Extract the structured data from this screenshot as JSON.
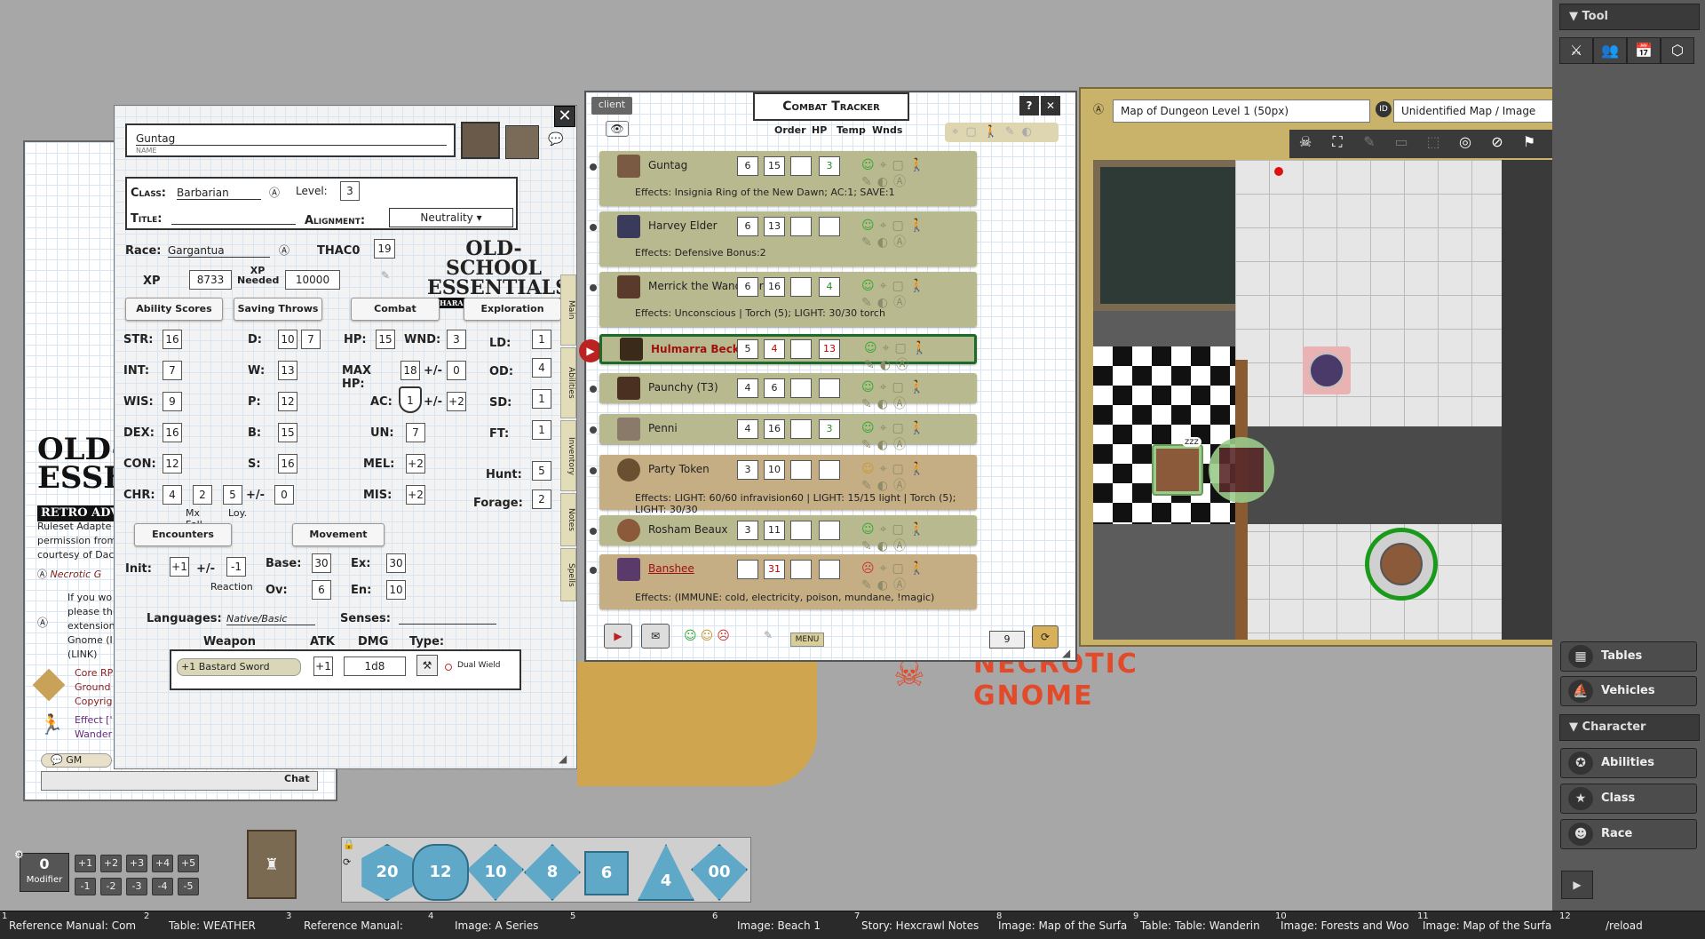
{
  "char_sheet": {
    "name": "Guntag",
    "name_caption": "NAME",
    "class_label": "Class:",
    "class": "Barbarian",
    "level_label": "Level:",
    "level": "3",
    "title_label": "Title:",
    "alignment_label": "Alignment:",
    "alignment": "Neutrality",
    "race_label": "Race:",
    "race": "Gargantua",
    "thac0_label": "THAC0",
    "thac0": "19",
    "xp_label": "XP",
    "xp": "8733",
    "xp_needed_label": "XP Needed",
    "xp_needed": "10000",
    "logo_line1": "OLD-SCHOOL",
    "logo_line2": "ESSENTIALS",
    "logo_line3": "CHARACTER RECORD SHEET",
    "sections": [
      "Ability Scores",
      "Saving Throws",
      "Combat",
      "Exploration"
    ],
    "abilities": [
      {
        "label": "STR:",
        "value": "16"
      },
      {
        "label": "INT:",
        "value": "7"
      },
      {
        "label": "WIS:",
        "value": "9"
      },
      {
        "label": "DEX:",
        "value": "16"
      },
      {
        "label": "CON:",
        "value": "12"
      },
      {
        "label": "CHR:",
        "value": "4"
      }
    ],
    "chr_extra": {
      "mx_foll": "2",
      "loy": "5",
      "pm": "0",
      "mx_foll_label": "Mx Foll",
      "loy_label": "Loy."
    },
    "saves": [
      {
        "label": "D:",
        "value": "10",
        "mod": "7"
      },
      {
        "label": "W:",
        "value": "13"
      },
      {
        "label": "P:",
        "value": "12"
      },
      {
        "label": "B:",
        "value": "15"
      },
      {
        "label": "S:",
        "value": "16"
      }
    ],
    "combat": {
      "hp_label": "HP:",
      "hp": "15",
      "wnd_label": "WND:",
      "wnd": "3",
      "maxhp_label": "MAX HP:",
      "maxhp": "18",
      "maxhp_pm": "0",
      "ac_label": "AC:",
      "ac": "1",
      "ac_pm": "+2",
      "un_label": "UN:",
      "un": "7",
      "mel_label": "MEL:",
      "mel": "+2",
      "mis_label": "MIS:",
      "mis": "+2",
      "pm_label": "+/-"
    },
    "exploration": [
      {
        "label": "LD:",
        "value": "1"
      },
      {
        "label": "OD:",
        "value": "4"
      },
      {
        "label": "SD:",
        "value": "1"
      },
      {
        "label": "FT:",
        "value": "1"
      },
      {
        "label": "Hunt:",
        "value": "5"
      },
      {
        "label": "Forage:",
        "value": "2"
      }
    ],
    "encounters_label": "Encounters",
    "movement_label": "Movement",
    "init_label": "Init:",
    "init": "+1",
    "init_pm": "-1",
    "reaction_label": "Reaction",
    "base_label": "Base:",
    "base": "30",
    "ex_label": "Ex:",
    "ex": "30",
    "ov_label": "Ov:",
    "ov": "6",
    "en_label": "En:",
    "en": "10",
    "languages_label": "Languages:",
    "languages": "Native/Basic",
    "senses_label": "Senses:",
    "weapon_header": "Weapon",
    "atk_header": "ATK",
    "dmg_header": "DMG",
    "type_header": "Type:",
    "weapon": {
      "name": "+1 Bastard Sword",
      "atk": "+1",
      "dmg": "1d8",
      "dual": "Dual Wield"
    },
    "side_tabs": [
      "Main",
      "Abilities",
      "Inventory",
      "Notes",
      "Spells"
    ]
  },
  "chat": {
    "logo1": "OLD-S",
    "logo2": "ESSE",
    "logo3": "RETRO ADV",
    "lines": [
      "Ruleset Adapte",
      "permission from",
      "courtesy of Dac"
    ],
    "necrotic": "Necrotic G",
    "ext_lines": [
      "If you wo",
      "please thi",
      "extension",
      "Gnome (I",
      "(LINK)"
    ],
    "core": [
      "Core RP",
      "Ground",
      "Copyrig"
    ],
    "effect": [
      "Effect ['",
      "Wander"
    ],
    "gm_label": "GM",
    "chat_btn": "Chat"
  },
  "combat_tracker": {
    "title": "Combat Tracker",
    "client_tab": "client",
    "col_order": "Order",
    "col_hp": "HP",
    "col_temp": "Temp",
    "col_wnds": "Wnds",
    "rows": [
      {
        "name": "Guntag",
        "order": "6",
        "hp": "15",
        "temp": "",
        "wnds": "3",
        "effects": "Effects: Insignia Ring of the New Dawn; AC:1; SAVE:1"
      },
      {
        "name": "Harvey Elder",
        "order": "6",
        "hp": "13",
        "temp": "",
        "wnds": "",
        "effects": "Effects: Defensive Bonus:2"
      },
      {
        "name": "Merrick the Wanderer",
        "order": "6",
        "hp": "16",
        "temp": "",
        "wnds": "4",
        "effects": "Effects: Unconscious | Torch (5); LIGHT: 30/30 torch"
      },
      {
        "name": "Hulmarra Beckett",
        "order": "5",
        "hp": "4",
        "temp": "",
        "wnds": "13",
        "effects": ""
      },
      {
        "name": "Paunchy (T3)",
        "order": "4",
        "hp": "6",
        "temp": "",
        "wnds": "",
        "effects": ""
      },
      {
        "name": "Penni",
        "order": "4",
        "hp": "16",
        "temp": "",
        "wnds": "3",
        "effects": ""
      },
      {
        "name": "Party Token",
        "order": "3",
        "hp": "10",
        "temp": "",
        "wnds": "",
        "effects": "Effects: LIGHT: 60/60 infravision60 | LIGHT: 15/15 light | Torch (5); LIGHT: 30/30"
      },
      {
        "name": "Rosham Beaux",
        "order": "3",
        "hp": "11",
        "temp": "",
        "wnds": "",
        "effects": ""
      },
      {
        "name": "Banshee",
        "order": "",
        "hp": "31",
        "temp": "",
        "wnds": "",
        "effects": "Effects: (IMMUNE: cold, electricity, poison, mundane, !magic)"
      }
    ],
    "menu_label": "MENU",
    "round": "9",
    "help": "?",
    "close": "✕"
  },
  "map": {
    "title": "Map of Dungeon Level 1 (50px)",
    "image_title": "Unidentified Map / Image"
  },
  "sidebar": {
    "tool_header": "Tool",
    "character_header": "Character",
    "items_top": [
      "Tables",
      "Vehicles"
    ],
    "items_char": [
      "Abilities",
      "Class",
      "Race"
    ]
  },
  "modifier": {
    "value": "0",
    "label": "Modifier",
    "plus": [
      "+1",
      "+2",
      "+3",
      "+4",
      "+5"
    ],
    "minus": [
      "-1",
      "-2",
      "-3",
      "-4",
      "-5"
    ]
  },
  "dice": [
    "20",
    "12",
    "10",
    "8",
    "6",
    "4",
    "00"
  ],
  "publisher_logo1": "NECROTIC",
  "publisher_logo2": "GNOME",
  "hotkeys": [
    {
      "num": "1",
      "label": "Reference Manual: Com"
    },
    {
      "num": "2",
      "label": "Table: WEATHER"
    },
    {
      "num": "3",
      "label": "Reference Manual:"
    },
    {
      "num": "4",
      "label": "Image: A Series"
    },
    {
      "num": "5",
      "label": ""
    },
    {
      "num": "6",
      "label": "Image: Beach 1"
    },
    {
      "num": "7",
      "label": "Story: Hexcrawl Notes"
    },
    {
      "num": "8",
      "label": "Image: Map of the Surfa"
    },
    {
      "num": "9",
      "label": "Table: Table: Wanderin"
    },
    {
      "num": "10",
      "label": "Image: Forests and Woo"
    },
    {
      "num": "11",
      "label": "Image: Map of the Surfa"
    },
    {
      "num": "12",
      "label": "/reload"
    }
  ]
}
